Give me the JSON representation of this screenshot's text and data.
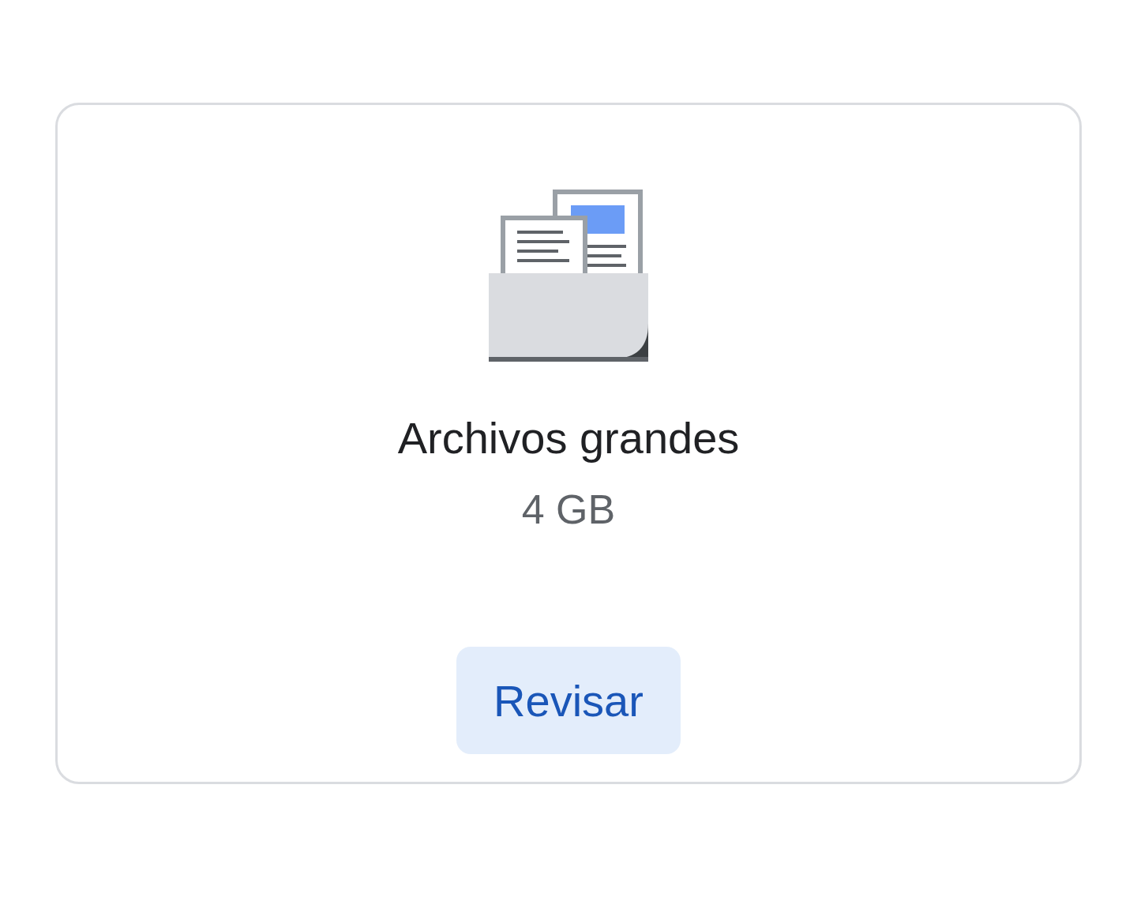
{
  "card": {
    "title": "Archivos grandes",
    "size": "4 GB",
    "button": "Revisar"
  }
}
